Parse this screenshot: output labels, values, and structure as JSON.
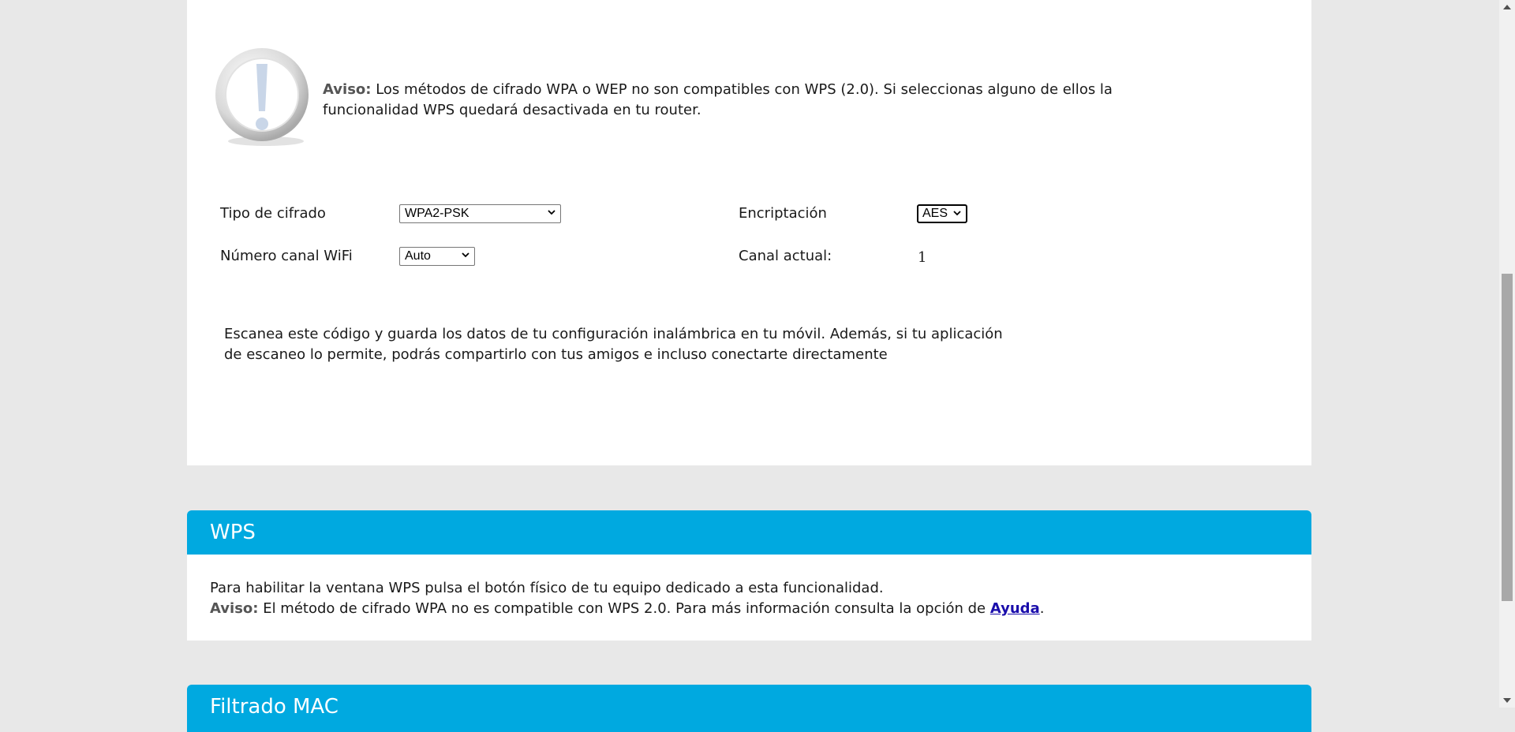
{
  "warning": {
    "label": "Aviso:",
    "text": " Los métodos de cifrado WPA o WEP no son compatibles con WPS (2.0). Si seleccionas alguno de ellos la funcionalidad WPS quedará desactivada en tu router.",
    "icon": "exclamation-icon"
  },
  "form": {
    "cipher_type_label": "Tipo de cifrado",
    "cipher_type_value": "WPA2-PSK",
    "encryption_label": "Encriptación",
    "encryption_value": "AES",
    "wifi_channel_label": "Número canal WiFi",
    "wifi_channel_value": "Auto",
    "current_channel_label": "Canal actual:",
    "current_channel_value": "1"
  },
  "scan_text": "Escanea este código y guarda los datos de tu configuración inalámbrica en tu móvil. Además, si tu aplicación de escaneo lo permite, podrás compartirlo con tus amigos e incluso conectarte directamente",
  "wps": {
    "title": "WPS",
    "line1": "Para habilitar la ventana WPS pulsa el botón físico de tu equipo dedicado a esta funcionalidad.",
    "aviso_label": "Aviso:",
    "line2": " El método de cifrado WPA no es compatible con WPS 2.0. Para más información consulta la opción de ",
    "help_link": "Ayuda",
    "line2_end": "."
  },
  "mac_filter": {
    "title": "Filtrado MAC"
  },
  "colors": {
    "accent": "#00a9e0",
    "background": "#e8e8e8",
    "panel": "#ffffff"
  }
}
